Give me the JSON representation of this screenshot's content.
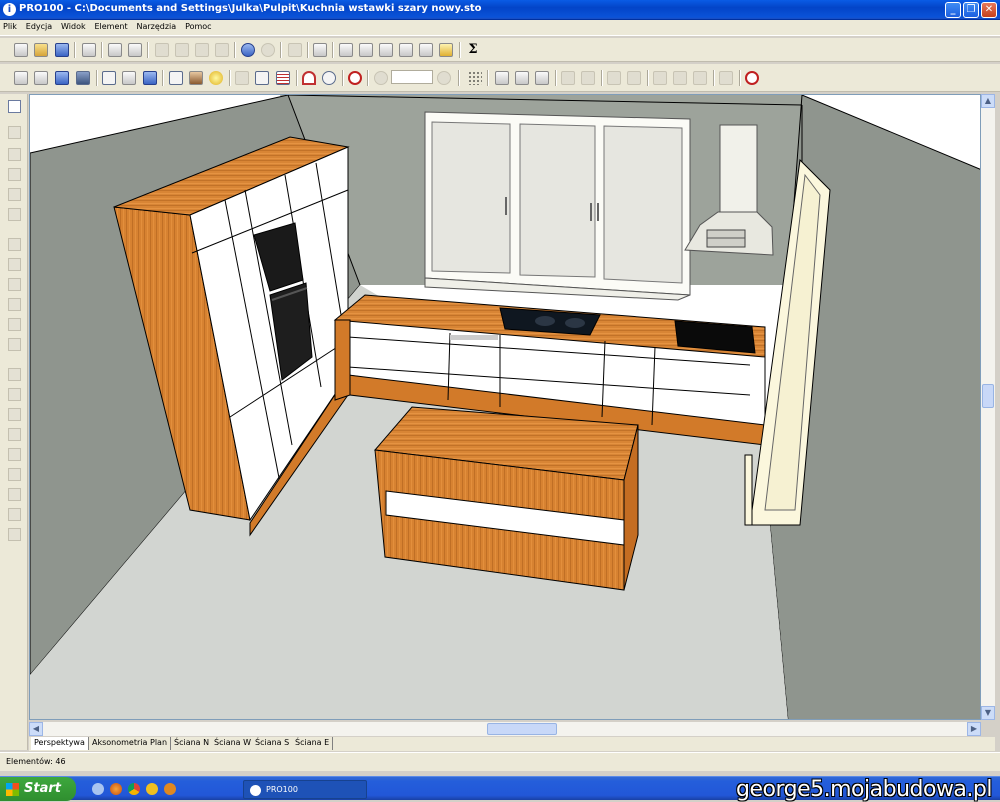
{
  "window": {
    "title": "PRO100 - C:\\Documents and Settings\\Julka\\Pulpit\\Kuchnia wstawki szary nowy.sto",
    "app_icon": "pro100-app-icon",
    "buttons": {
      "minimize": "_",
      "maximize": "❐",
      "close": "✕"
    }
  },
  "menu": {
    "items": [
      "Plik",
      "Edycja",
      "Widok",
      "Element",
      "Narzędzia",
      "Pomoc"
    ]
  },
  "toolbar1": {
    "icons": [
      "new-file-icon",
      "open-folder-icon",
      "save-icon",
      "edit-document-icon",
      "print-icon",
      "print-preview-icon",
      "cut-icon",
      "copy-icon",
      "paste-icon",
      "delete-icon",
      "undo-icon",
      "redo-icon",
      "library-icon",
      "properties-icon",
      "element-list-icon",
      "view-front-icon",
      "view-zoom-icon",
      "view-width-icon",
      "view-hide-icon",
      "render-icon",
      "sum-icon"
    ]
  },
  "toolbar2": {
    "icons": [
      "wireframe-view-icon",
      "hidden-lines-icon",
      "solid-view-icon",
      "textured-view-icon",
      "box-outline-icon",
      "box-outline2-icon",
      "box-solid-icon",
      "text-labels-icon",
      "materials-icon",
      "light-bulb-icon",
      "snap-icon",
      "dimension-icon",
      "grid-icon",
      "magnet-icon",
      "target-icon",
      "center-icon",
      "zoom-in-icon",
      "zoom-out-icon",
      "grid-dots-icon",
      "align-icon",
      "select-arrow-icon",
      "pencil-icon",
      "align-left-icon",
      "align-right-icon",
      "move-up-icon",
      "rotate-icon",
      "move-icon",
      "warning-icon",
      "door-icon",
      "stop-icon"
    ],
    "zoom_value": ""
  },
  "left_toolbar": {
    "icons": [
      "pointer-icon",
      "scale-icon",
      "cube-icon",
      "align-top-icon",
      "align-bottom-icon",
      "zoom-tool-icon",
      "distribute-icon",
      "stack-icon",
      "stack2-icon",
      "shelf-icon",
      "copy-element-icon",
      "group-icon",
      "ungroup-icon",
      "bars-icon",
      "bars2-icon",
      "columns-icon",
      "columns2-icon",
      "grid2-icon",
      "link-icon",
      "wall-icon",
      "rotate-tool-icon"
    ]
  },
  "view_tabs": [
    "Perspektywa",
    "Aksonometria",
    "Plan",
    "Ściana N",
    "Ściana W",
    "Ściana S",
    "Ściana E"
  ],
  "active_tab": "Perspektywa",
  "status": {
    "elements": "Elementów: 46"
  },
  "taskbar": {
    "start_label": "Start",
    "task_label": "PRO100",
    "quick_launch": [
      "desktop-icon",
      "firefox-icon",
      "chrome-icon",
      "outlook-icon",
      "winamp-icon"
    ]
  },
  "watermark": "george5.mojabudowa.pl",
  "colors": {
    "wall": "#9da39b",
    "floor": "#d0d3cf",
    "wood": "#d67f2e",
    "cabinet": "#ffffff",
    "titlebar": "#0a53d8"
  }
}
